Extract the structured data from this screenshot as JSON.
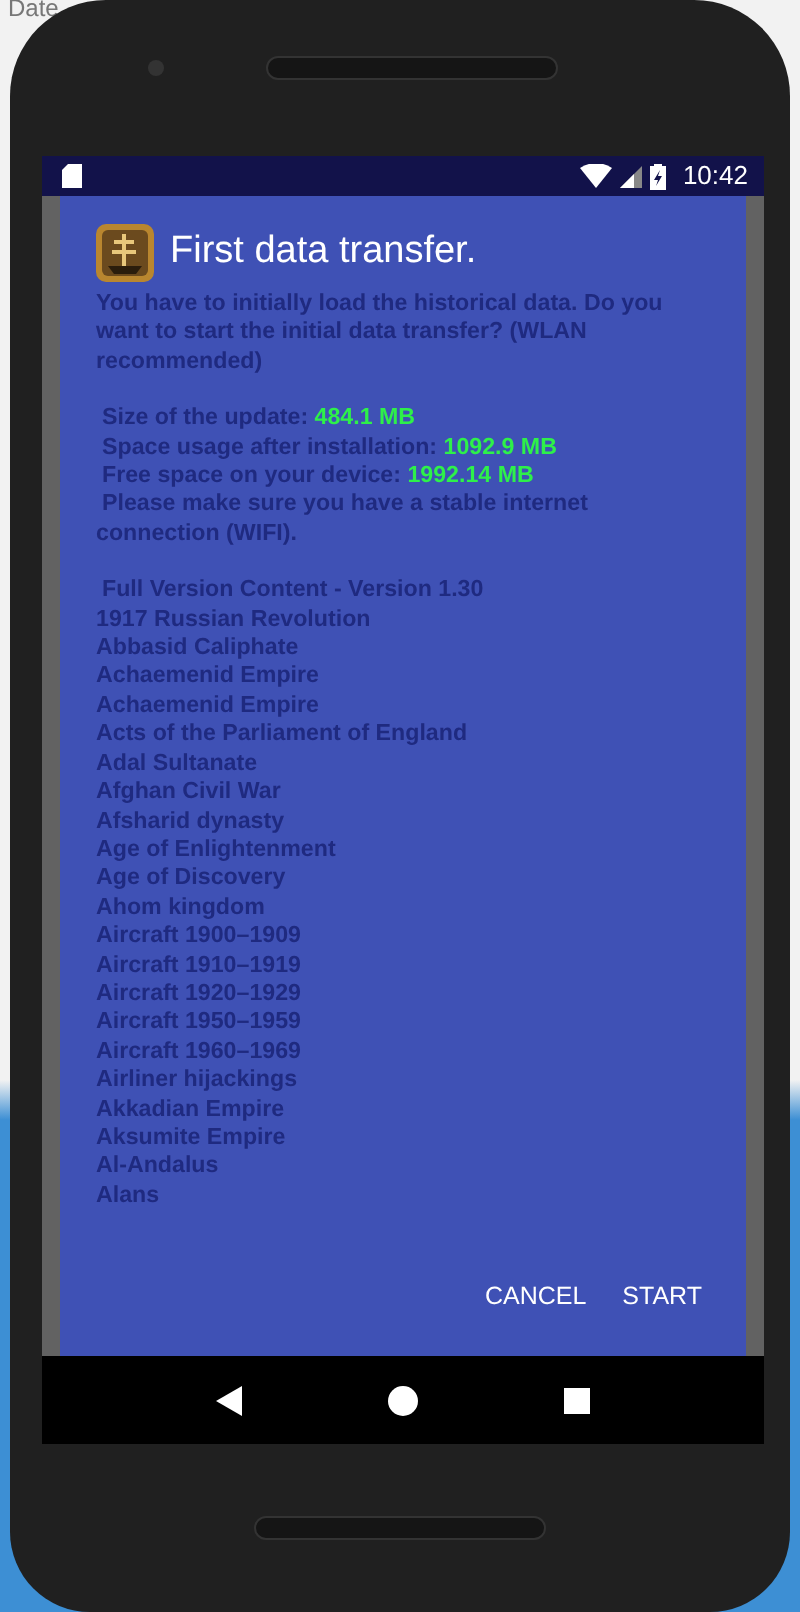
{
  "background_window": {
    "menu_text": "Date"
  },
  "status_bar": {
    "time": "10:42"
  },
  "dialog": {
    "title": "First data transfer.",
    "message": "You have to initially load the historical data. Do you want to start the initial data transfer? (WLAN recommended)",
    "details": [
      {
        "label": "Size of the update: ",
        "value": "484.1 MB"
      },
      {
        "label": "Space usage after installation: ",
        "value": "1092.9 MB"
      },
      {
        "label": "Free space on your device: ",
        "value": "1992.14 MB"
      }
    ],
    "note": "Please make sure you have a stable internet connection (WIFI).",
    "list_heading": "Full Version Content - Version 1.30",
    "items": [
      "1917 Russian Revolution",
      "Abbasid Caliphate",
      "Achaemenid Empire",
      "Achaemenid Empire",
      "Acts of the Parliament of England",
      "Adal Sultanate",
      "Afghan Civil War",
      "Afsharid dynasty",
      "Age of Enlightenment",
      "Age of Discovery",
      "Ahom kingdom",
      "Aircraft 1900–1909",
      "Aircraft 1910–1919",
      "Aircraft 1920–1929",
      "Aircraft 1950–1959",
      "Aircraft 1960–1969",
      "Airliner hijackings",
      "Akkadian Empire",
      "Aksumite Empire",
      "Al-Andalus",
      "Alans"
    ],
    "buttons": [
      "CANCEL",
      "START"
    ]
  }
}
